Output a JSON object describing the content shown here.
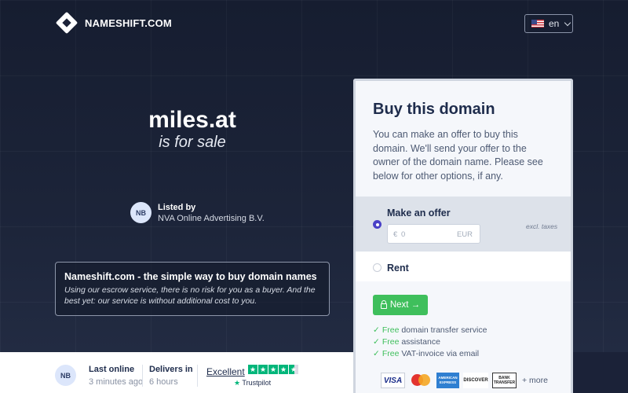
{
  "header": {
    "logo_text": "NAMESHIFT.COM",
    "language": "en"
  },
  "hero": {
    "domain": "miles.at",
    "subtitle": "is for sale",
    "listed_title": "Listed by",
    "listed_name": "NVA Online Advertising B.V.",
    "avatar_initials": "NB"
  },
  "promo": {
    "title": "Nameshift.com - the simple way to buy domain names",
    "text": "Using our escrow service, there is no risk for you as a buyer. And the best yet: our service is without additional cost to you."
  },
  "card": {
    "title": "Buy this domain",
    "description": "You can make an offer to buy this domain. We'll send your offer to the owner of the domain name. Please see below for other options, if any.",
    "offer_label": "Make an offer",
    "excl_taxes": "excl. taxes",
    "currency_symbol": "€",
    "offer_placeholder": "0",
    "currency_code": "EUR",
    "rent_label": "Rent",
    "next_label": "Next →",
    "features": [
      {
        "free": "Free",
        "text": " domain transfer service"
      },
      {
        "free": "Free",
        "text": " assistance"
      },
      {
        "free": "Free",
        "text": " VAT-invoice via email"
      }
    ],
    "payments": [
      "VISA",
      "AMERICAN EXPRESS",
      "DISCOVER",
      "BANK TRANSFER"
    ],
    "more_label": "+ more"
  },
  "footer": {
    "avatar_initials": "NB",
    "last_online_title": "Last online",
    "last_online_value": "3 minutes ago",
    "delivers_title": "Delivers in",
    "delivers_value": "6 hours",
    "trustpilot_label": "Excellent",
    "trustpilot_brand": "Trustpilot",
    "trustpilot_rating": 4.5
  },
  "colors": {
    "accent_green": "#3fbf5c",
    "radio_purple": "#4a41c7",
    "background_navy": "#1b2238",
    "trustpilot_green": "#00b67a"
  }
}
